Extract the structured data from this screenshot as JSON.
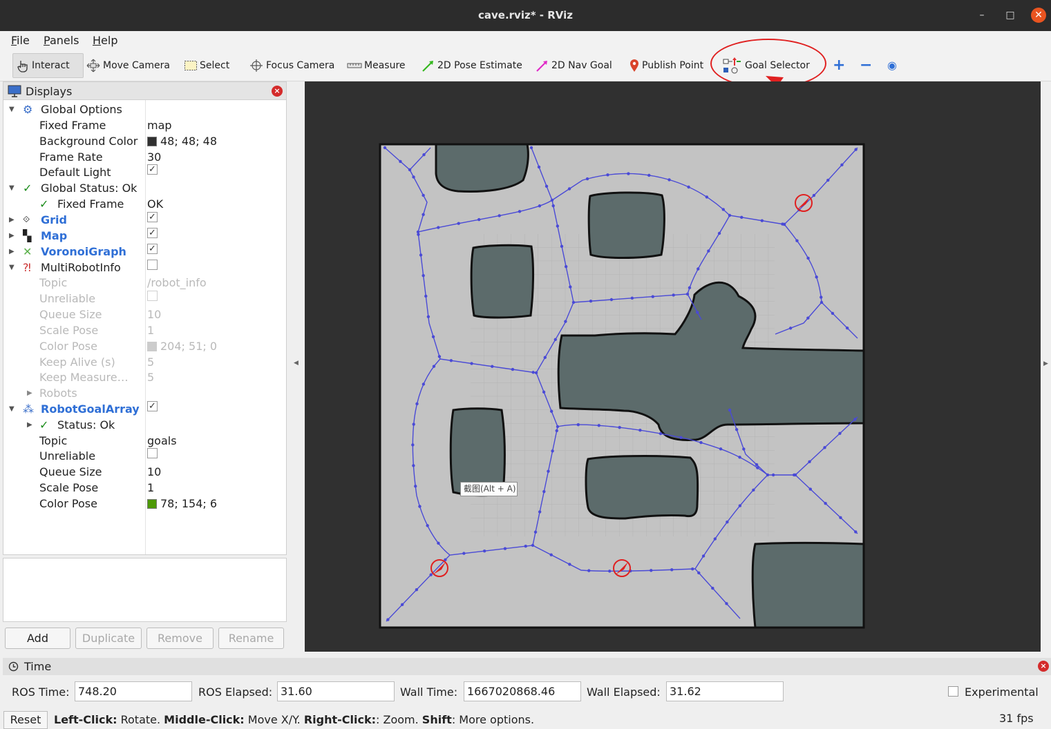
{
  "window": {
    "title": "cave.rviz* - RViz",
    "minimize_glyph": "–",
    "maximize_glyph": "□",
    "close_glyph": "✕"
  },
  "menu": {
    "file_accel": "F",
    "file_rest": "ile",
    "panels_accel": "P",
    "panels_rest": "anels",
    "help_accel": "H",
    "help_rest": "elp"
  },
  "toolbar": {
    "interact": "Interact",
    "move_camera": "Move Camera",
    "select": "Select",
    "focus_camera": "Focus Camera",
    "measure": "Measure",
    "pose_estimate": "2D Pose Estimate",
    "nav_goal": "2D Nav Goal",
    "publish_point": "Publish Point",
    "goal_selector": "Goal  Selector",
    "add_tool": "+",
    "remove_tool": "−",
    "view_tool": "◉"
  },
  "displays": {
    "title": "Displays",
    "close_glyph": "×",
    "rows": [
      {
        "k": "Global Options",
        "v": ""
      },
      {
        "k": "Fixed Frame",
        "v": "map"
      },
      {
        "k": "Background Color",
        "v": "48; 48; 48"
      },
      {
        "k": "Frame Rate",
        "v": "30"
      },
      {
        "k": "Default Light",
        "v": "✓"
      },
      {
        "k": "Global Status: Ok",
        "v": ""
      },
      {
        "k": "Fixed Frame",
        "v": "OK"
      },
      {
        "k": "Grid",
        "v": "✓"
      },
      {
        "k": "Map",
        "v": "✓"
      },
      {
        "k": "VoronoiGraph",
        "v": "✓"
      },
      {
        "k": "MultiRobotInfo",
        "v": ""
      },
      {
        "k": "Topic",
        "v": "/robot_info"
      },
      {
        "k": "Unreliable",
        "v": ""
      },
      {
        "k": "Queue Size",
        "v": "10"
      },
      {
        "k": "Scale Pose",
        "v": "1"
      },
      {
        "k": "Color Pose",
        "v": "204; 51; 0"
      },
      {
        "k": "Keep Alive (s)",
        "v": "5"
      },
      {
        "k": "Keep Measure…",
        "v": "5"
      },
      {
        "k": "Robots",
        "v": ""
      },
      {
        "k": "RobotGoalArray",
        "v": "✓"
      },
      {
        "k": "Status: Ok",
        "v": ""
      },
      {
        "k": "Topic",
        "v": "goals"
      },
      {
        "k": "Unreliable",
        "v": ""
      },
      {
        "k": "Queue Size",
        "v": "10"
      },
      {
        "k": "Scale Pose",
        "v": "1"
      },
      {
        "k": "Color Pose",
        "v": "78; 154; 6"
      }
    ],
    "colors": {
      "background": "#303030",
      "multi_pose": "#cccccc",
      "goal_pose": "#4e9a06"
    },
    "buttons": {
      "add": "Add",
      "duplicate": "Duplicate",
      "remove": "Remove",
      "rename": "Rename"
    }
  },
  "viewport": {
    "tooltip": "截图(Alt + A)"
  },
  "time": {
    "title": "Time",
    "ros_time_label": "ROS Time:",
    "ros_time": "748.20",
    "ros_elapsed_label": "ROS Elapsed:",
    "ros_elapsed": "31.60",
    "wall_time_label": "Wall Time:",
    "wall_time": "1667020868.46",
    "wall_elapsed_label": "Wall Elapsed:",
    "wall_elapsed": "31.62",
    "experimental": "Experimental"
  },
  "status": {
    "reset": "Reset",
    "lc": "Left-Click:",
    "lc_t": " Rotate. ",
    "mc": "Middle-Click:",
    "mc_t": " Move X/Y. ",
    "rc": "Right-Click:",
    "rc_t": ": Zoom. ",
    "sh": "Shift",
    "sh_t": ": More options.",
    "fps": "31 fps"
  }
}
